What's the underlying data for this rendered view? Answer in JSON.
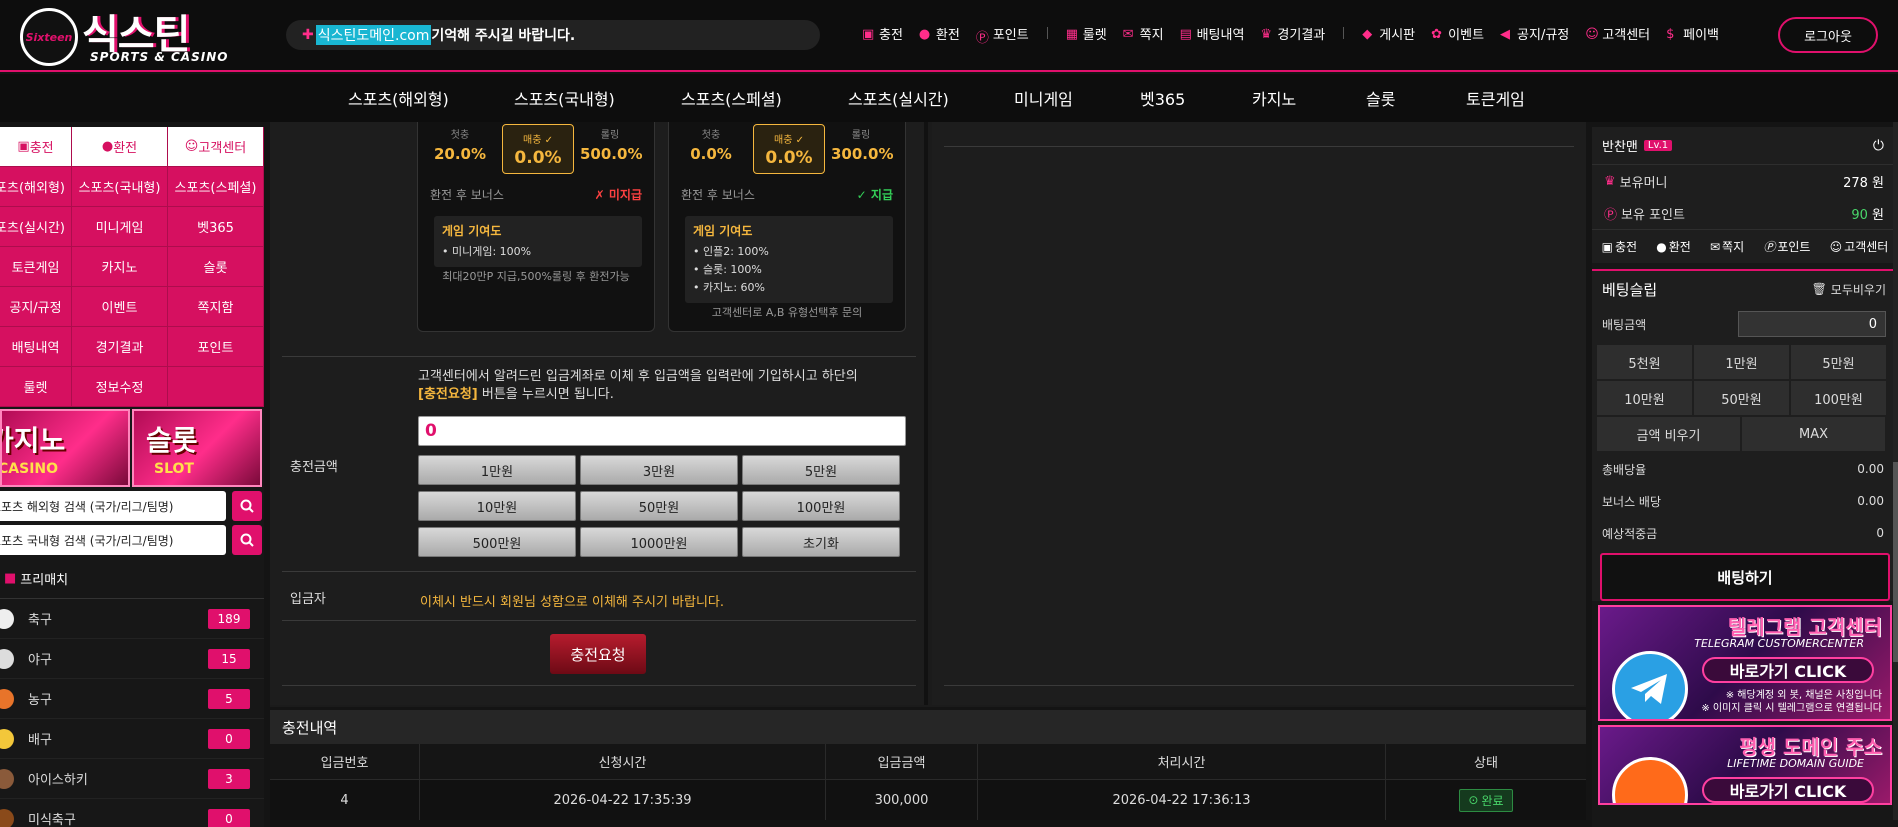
{
  "brand": {
    "circle": "Sixteen",
    "main": "식스틴",
    "sub": "SPORTS & CASINO"
  },
  "notice": {
    "highlight": "식스틴도메인.com",
    "rest": " 기억해 주시길 바랍니다."
  },
  "topmenu": [
    "충전",
    "환전",
    "포인트",
    "룰렛",
    "쪽지",
    "배팅내역",
    "경기결과",
    "게시판",
    "이벤트",
    "공지/규정",
    "고객센터",
    "페이백"
  ],
  "logout_label": "로그아웃",
  "nav": [
    "스포츠(해외형)",
    "스포츠(국내형)",
    "스포츠(스페셜)",
    "스포츠(실시간)",
    "미니게임",
    "벳365",
    "카지노",
    "슬롯",
    "토큰게임"
  ],
  "leftmenu": [
    [
      "충전",
      "환전",
      "고객센터"
    ],
    [
      "스포츠(해외형)",
      "스포츠(국내형)",
      "스포츠(스페셜)"
    ],
    [
      "스포츠(실시간)",
      "미니게임",
      "벳365"
    ],
    [
      "토큰게임",
      "카지노",
      "슬롯"
    ],
    [
      "공지/규정",
      "이벤트",
      "쪽지함"
    ],
    [
      "배팅내역",
      "경기결과",
      "포인트"
    ],
    [
      "룰렛",
      "정보수정",
      ""
    ]
  ],
  "banners": {
    "casino_title": "카지노",
    "casino_sub": "CASINO",
    "slot_title": "슬롯",
    "slot_sub": "SLOT"
  },
  "search": {
    "overseas": "스포츠 해외형 검색 (국가/리그/팀명)",
    "domestic": "스포츠 국내형 검색 (국가/리그/팀명)"
  },
  "prematch_label": "프리매치",
  "sports": [
    {
      "name": "축구",
      "count": "189",
      "color": "#eeeeee"
    },
    {
      "name": "야구",
      "count": "15",
      "color": "#dddddd"
    },
    {
      "name": "농구",
      "count": "5",
      "color": "#e8742a"
    },
    {
      "name": "배구",
      "count": "0",
      "color": "#f3c73a"
    },
    {
      "name": "아이스하키",
      "count": "3",
      "color": "#8a5a3a"
    },
    {
      "name": "미식축구",
      "count": "0",
      "color": "#8a4a1a"
    }
  ],
  "card1": {
    "s1_label": "첫충",
    "s1_value": "20.0%",
    "s2_label": "매충 ✓",
    "s2_value": "0.0%",
    "s3_label": "롤링",
    "s3_value": "500.0%",
    "bonus_label": "환전 후 보너스",
    "bonus_status": "✗ 미지급",
    "contrib_title": "게임 기여도",
    "items": [
      "• 미니게임: 100%"
    ],
    "footer": "최대20만P 지급,500%롤링 후 환전가능"
  },
  "card2": {
    "s1_label": "첫충",
    "s1_value": "0.0%",
    "s2_label": "매충 ✓",
    "s2_value": "0.0%",
    "s3_label": "롤링",
    "s3_value": "300.0%",
    "bonus_label": "환전 후 보너스",
    "bonus_status": "✓ 지급",
    "contrib_title": "게임 기여도",
    "items": [
      "• 인플2: 100%",
      "• 슬롯: 100%",
      "• 카지노: 60%"
    ],
    "footer": "고객센터로 A,B 유형선택후 문의"
  },
  "charge": {
    "label": "충전금액",
    "instr1": "고객센터에서 알려드린 입금계좌로 이체 후 입금액을 입력란에 기입하시고 하단의",
    "instr_highlight": "[충전요청]",
    "instr2": " 버튼을 누르시면 됩니다.",
    "amount": "0",
    "quick": [
      "1만원",
      "3만원",
      "5만원",
      "10만원",
      "50만원",
      "100만원",
      "500만원",
      "1000만원",
      "초기화"
    ],
    "depositor_label": "입금자",
    "depositor_note": "이체시 반드시 회원님 성함으로 이체해 주시기 바랍니다.",
    "request_button": "충전요청"
  },
  "history": {
    "title": "충전내역",
    "columns": [
      "입금번호",
      "신청시간",
      "입금금액",
      "처리시간",
      "상태"
    ],
    "rows": [
      {
        "id": "4",
        "requested": "2026-04-22 17:35:39",
        "amount": "300,000",
        "processed": "2026-04-22 17:36:13",
        "status": "완료"
      }
    ]
  },
  "user": {
    "name": "반찬맨",
    "level": "Lv.1",
    "money_label": "보유머니",
    "money_value": "278",
    "money_unit": "원",
    "point_label": "보유 포인트",
    "point_value": "90",
    "point_unit": "원",
    "quick": [
      "충전",
      "환전",
      "쪽지",
      "포인트",
      "고객센터"
    ]
  },
  "slip": {
    "title": "베팅슬립",
    "clear_all": "모두비우기",
    "amount_label": "배팅금액",
    "amount_value": "0",
    "amounts": [
      "5천원",
      "1만원",
      "5만원",
      "10만원",
      "50만원",
      "100만원"
    ],
    "clear_amount": "금액 비우기",
    "max": "MAX",
    "total_odds_label": "총배당율",
    "total_odds": "0.00",
    "bonus_odds_label": "보너스 배당",
    "bonus_odds": "0.00",
    "expected_label": "예상적중금",
    "expected": "0",
    "bet_button": "배팅하기"
  },
  "rbanner1": {
    "title": "텔레그램 고객센터",
    "sub": "TELEGRAM CUSTOMERCENTER",
    "cta": "바로가기 CLICK",
    "note1": "※ 해당계정 외 봇, 채널은 사칭입니다",
    "note2": "※ 이미지 클릭 시 텔레그램으로 연결됩니다"
  },
  "rbanner2": {
    "title": "평생 도메인 주소",
    "sub": "LIFETIME DOMAIN GUIDE",
    "cta": "바로가기 CLICK"
  },
  "colors": {
    "accent": "#e0106c",
    "gold": "#f5b73e",
    "success": "#49d66a",
    "danger": "#ff4141"
  }
}
